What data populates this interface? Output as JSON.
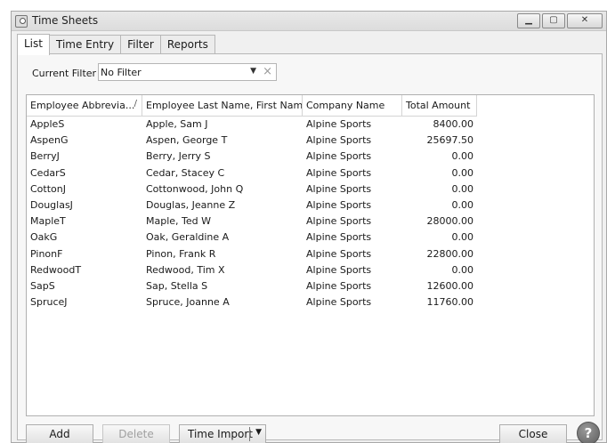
{
  "window": {
    "title": "Time Sheets"
  },
  "tabs": [
    "List",
    "Time Entry",
    "Filter",
    "Reports"
  ],
  "filter": {
    "label": "Current Filter",
    "value": "No Filter"
  },
  "grid": {
    "columns": [
      "Employee Abbrevia...",
      "Employee Last Name, First Name",
      "Company Name",
      "Total Amount"
    ],
    "sort_indicator": "/",
    "rows": [
      [
        "AppleS",
        "Apple, Sam J",
        "Alpine Sports",
        "8400.00"
      ],
      [
        "AspenG",
        "Aspen, George T",
        "Alpine Sports",
        "25697.50"
      ],
      [
        "BerryJ",
        "Berry, Jerry S",
        "Alpine Sports",
        "0.00"
      ],
      [
        "CedarS",
        "Cedar, Stacey C",
        "Alpine Sports",
        "0.00"
      ],
      [
        "CottonJ",
        "Cottonwood, John Q",
        "Alpine Sports",
        "0.00"
      ],
      [
        "DouglasJ",
        "Douglas, Jeanne Z",
        "Alpine Sports",
        "0.00"
      ],
      [
        "MapleT",
        "Maple, Ted W",
        "Alpine Sports",
        "28000.00"
      ],
      [
        "OakG",
        "Oak, Geraldine A",
        "Alpine Sports",
        "0.00"
      ],
      [
        "PinonF",
        "Pinon, Frank R",
        "Alpine Sports",
        "22800.00"
      ],
      [
        "RedwoodT",
        "Redwood, Tim X",
        "Alpine Sports",
        "0.00"
      ],
      [
        "SapS",
        "Sap, Stella S",
        "Alpine Sports",
        "12600.00"
      ],
      [
        "SpruceJ",
        "Spruce, Joanne A",
        "Alpine Sports",
        "11760.00"
      ]
    ]
  },
  "buttons": {
    "add": "Add",
    "delete": "Delete",
    "time_import": "Time Import",
    "close": "Close",
    "help": "?"
  },
  "icons": {
    "app": "timesheet-app-icon",
    "minimize": "minimize-icon",
    "maximize": "maximize-icon",
    "close": "close-icon",
    "dropdown": "chevron-down-icon",
    "clear": "clear-x-icon",
    "help": "help-icon"
  }
}
